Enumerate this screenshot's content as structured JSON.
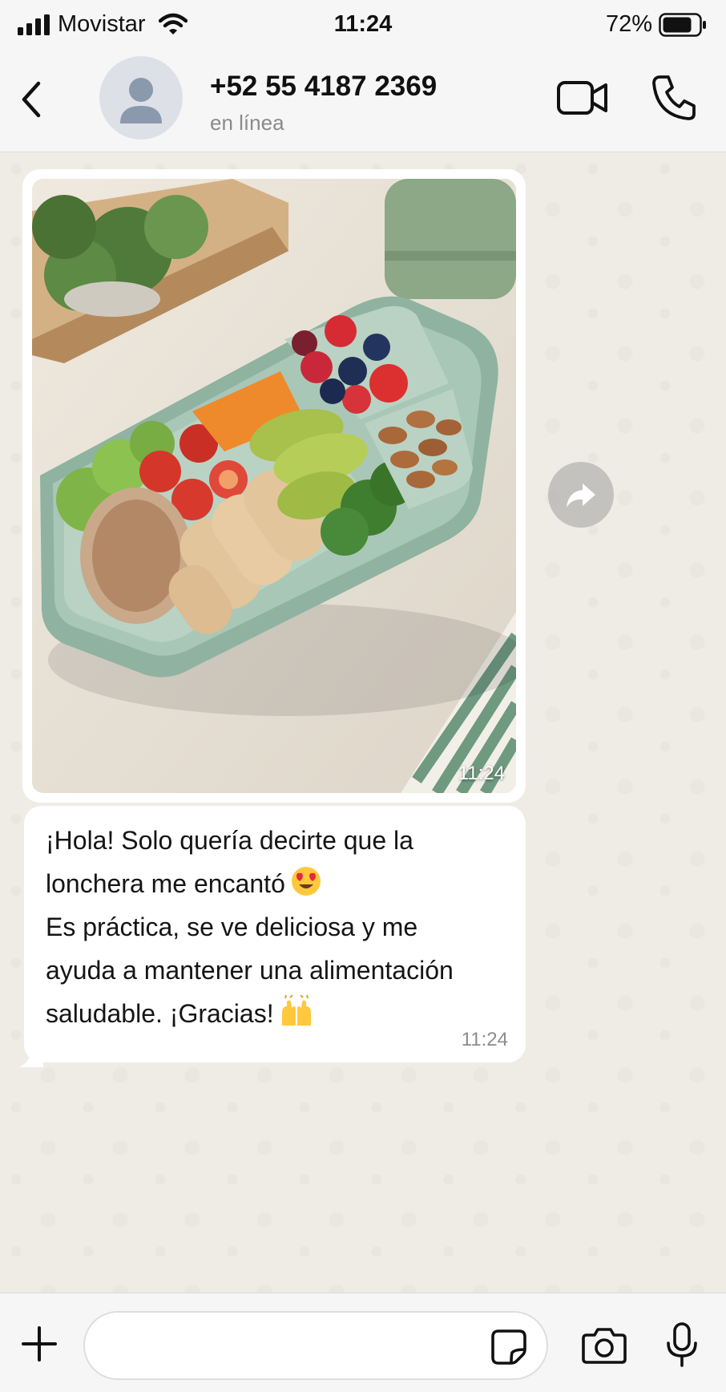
{
  "status_bar": {
    "carrier": "Movistar",
    "time": "11:24",
    "battery": "72%"
  },
  "header": {
    "contact_name": "+52 55 4187 2369",
    "contact_status": "en línea"
  },
  "messages": [
    {
      "type": "image",
      "image_description": "lunch-box-photo",
      "time": "11:24"
    },
    {
      "type": "text",
      "lines": [
        "¡Hola! Solo quería decirte que la",
        "lonchera me encantó",
        "Es práctica, se ve deliciosa y me",
        "ayuda a mantener una alimentación",
        "saludable. ¡Gracias!"
      ],
      "emojis": [
        "heart-eyes-emoji",
        "raising-hands-emoji"
      ],
      "time": "11:24"
    }
  ],
  "input": {
    "placeholder": ""
  },
  "icons": {
    "back": "chevron-left-icon",
    "video": "video-camera-icon",
    "phone": "phone-icon",
    "forward": "forward-arrow-icon",
    "plus": "plus-icon",
    "sticker": "sticker-icon",
    "camera": "camera-icon",
    "mic": "microphone-icon"
  },
  "colors": {
    "chat_background": "#efece5",
    "bubble": "#ffffff",
    "bar_background": "#f6f6f6"
  }
}
